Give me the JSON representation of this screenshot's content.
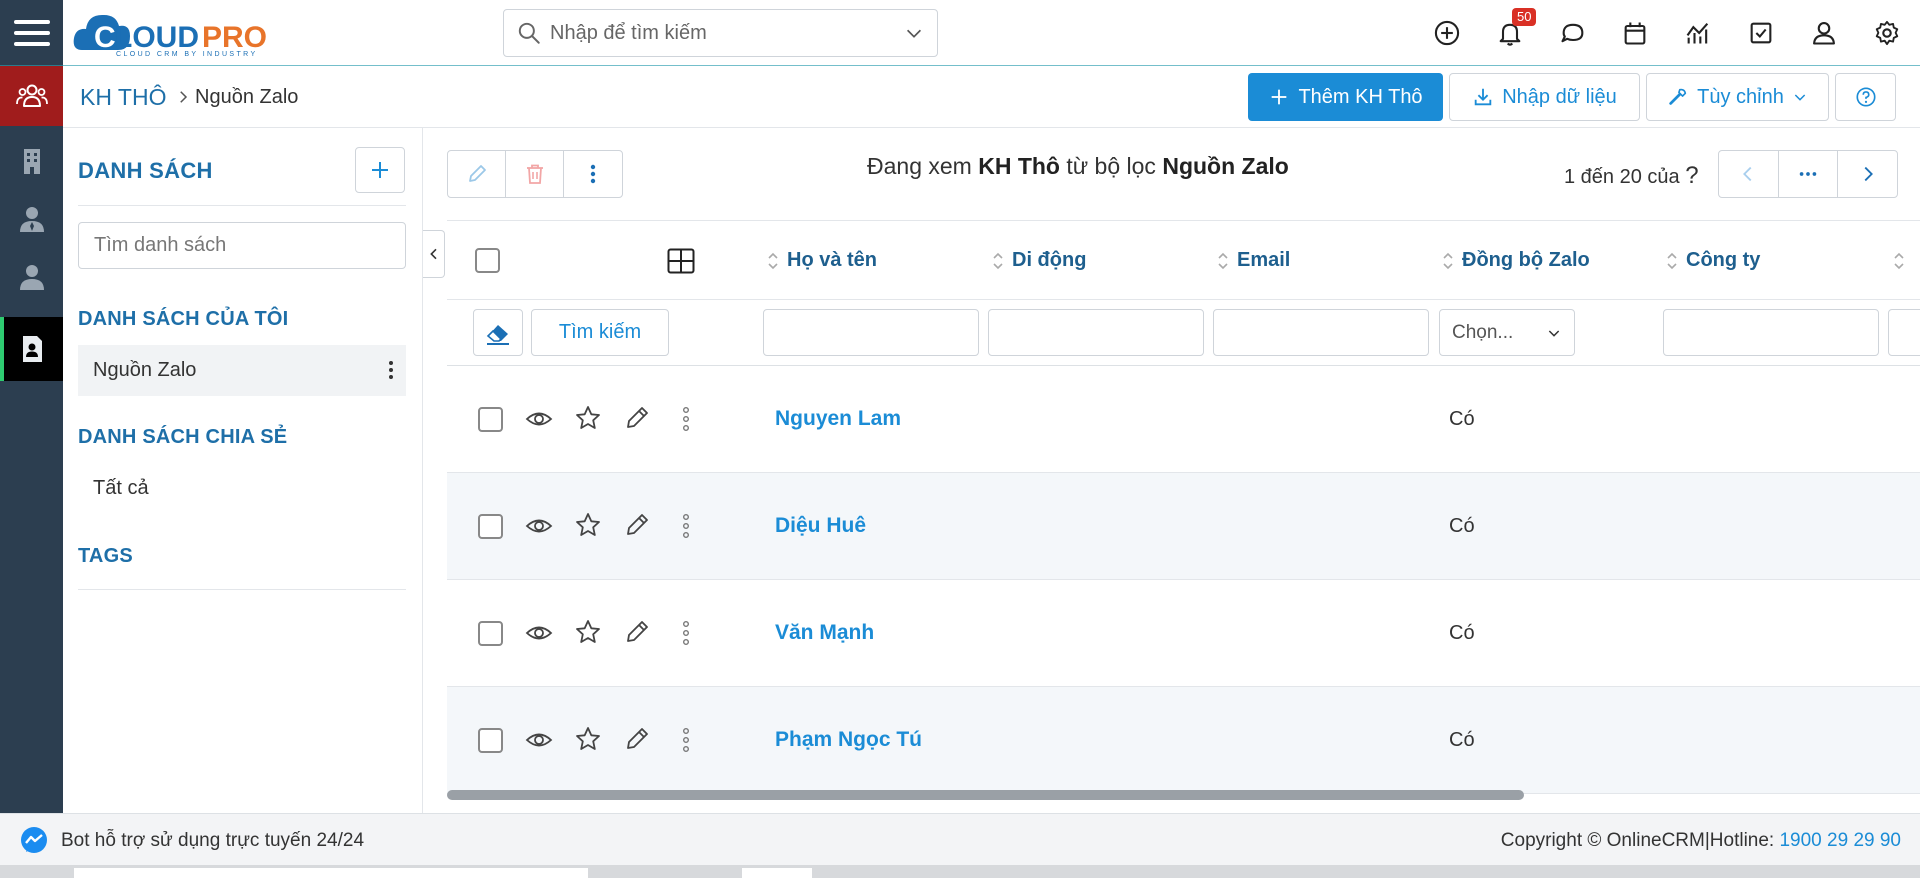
{
  "header": {
    "logo_text": "CLOUDPRO",
    "logo_tagline": "CLOUD CRM BY INDUSTRY",
    "search_placeholder": "Nhập để tìm kiếm",
    "notification_count": "50"
  },
  "breadcrumb": {
    "root": "KH THÔ",
    "current": "Nguồn Zalo"
  },
  "toolbar": {
    "add_label": "Thêm KH Thô",
    "import_label": "Nhập dữ liệu",
    "customize_label": "Tùy chỉnh"
  },
  "lists_panel": {
    "title": "DANH SÁCH",
    "search_placeholder": "Tìm danh sách",
    "my_lists_title": "DANH SÁCH CỦA TÔI",
    "my_lists": [
      "Nguồn Zalo"
    ],
    "shared_lists_title": "DANH SÁCH CHIA SẺ",
    "shared_lists": [
      "Tất cả"
    ],
    "tags_title": "TAGS"
  },
  "view_info": {
    "prefix": "Đang xem",
    "module": "KH Thô",
    "middle": "từ bộ lọc",
    "filter": "Nguồn Zalo"
  },
  "pagination": {
    "range_text": "1 đến 20 của",
    "total_unknown": "?"
  },
  "table": {
    "columns": [
      "Họ và tên",
      "Di động",
      "Email",
      "Đồng bộ Zalo",
      "Công ty"
    ],
    "search_button": "Tìm kiếm",
    "zalo_filter_placeholder": "Chọn...",
    "rows": [
      {
        "name": "Nguyen Lam",
        "zalo_sync": "Có"
      },
      {
        "name": "Diệu Huê",
        "zalo_sync": "Có"
      },
      {
        "name": "Văn Mạnh",
        "zalo_sync": "Có"
      },
      {
        "name": "Phạm Ngọc Tú",
        "zalo_sync": "Có"
      }
    ]
  },
  "footer": {
    "bot_text": "Bot hỗ trợ sử dụng trực tuyến 24/24",
    "copyright": "Copyright © OnlineCRM|Hotline:",
    "hotline": "1900 29 29 90"
  },
  "colors": {
    "primary": "#1b8cd6",
    "rail": "#2c3e50",
    "rail_highlight": "#a01c1c",
    "link": "#1e6fa8"
  }
}
